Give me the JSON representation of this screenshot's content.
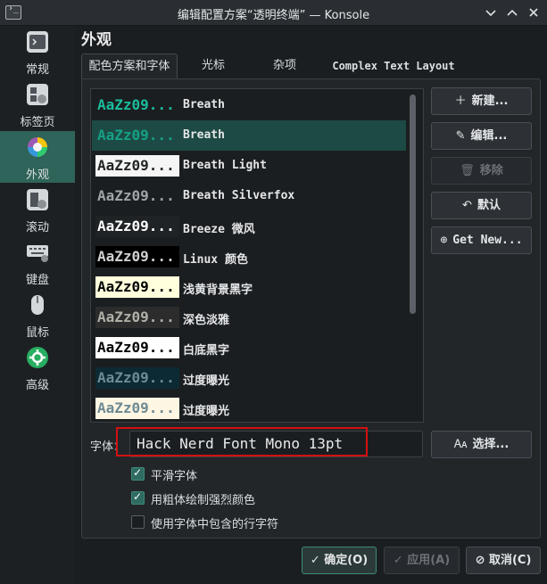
{
  "window": {
    "title": "编辑配置方案“透明终端” — Konsole",
    "icons": [
      "konsole-icon",
      "minimize-chevron",
      "maximize-chevron",
      "close-x"
    ]
  },
  "sidebar": {
    "items": [
      {
        "label": "常规",
        "icon": "terminal-icon"
      },
      {
        "label": "标签页",
        "icon": "tabs-icon"
      },
      {
        "label": "外观",
        "icon": "palette-icon"
      },
      {
        "label": "滚动",
        "icon": "scroll-icon"
      },
      {
        "label": "键盘",
        "icon": "keyboard-icon"
      },
      {
        "label": "鼠标",
        "icon": "mouse-icon"
      },
      {
        "label": "高级",
        "icon": "gear-icon"
      }
    ],
    "active": "外观"
  },
  "page": {
    "title": "外观",
    "tabs": [
      {
        "label": "配色方案和字体"
      },
      {
        "label": "光标"
      },
      {
        "label": "杂项"
      },
      {
        "label": "Complex Text Layout"
      }
    ]
  },
  "schemes": {
    "sample_text": "AaZz09...",
    "items": [
      {
        "name": "Breath",
        "bg": "#1b1e20",
        "fg": "#1abc9c"
      },
      {
        "name": "Breath",
        "bg": "#1d4a44",
        "fg": "#16a085"
      },
      {
        "name": "Breath Light",
        "bg": "#f5f5f5",
        "fg": "#232627"
      },
      {
        "name": "Breath Silverfox",
        "bg": "#1b1e20",
        "fg": "#a0a4a8"
      },
      {
        "name": "Breeze 微风",
        "bg": "#1f2326",
        "fg": "#fcfcfc"
      },
      {
        "name": "Linux 颜色",
        "bg": "#000000",
        "fg": "#d0d0d0"
      },
      {
        "name": "浅黄背景黑字",
        "bg": "#ffffdd",
        "fg": "#000000"
      },
      {
        "name": "深色淡雅",
        "bg": "#2c2c2c",
        "fg": "#b0b0a8"
      },
      {
        "name": "白底黑字",
        "bg": "#ffffff",
        "fg": "#000000"
      },
      {
        "name": "过度曝光",
        "bg": "#0c2a33",
        "fg": "#6e8a94"
      },
      {
        "name": "过度曝光",
        "bg": "#fdf6e3",
        "fg": "#6e8a94"
      }
    ]
  },
  "actions": {
    "new": "新建...",
    "edit": "编辑...",
    "remove": "移除",
    "default": "默认",
    "get_new": "Get New..."
  },
  "font": {
    "label": "字体：",
    "value": "Hack Nerd Font Mono 13pt",
    "select": "选择..."
  },
  "options": [
    {
      "label": "平滑字体",
      "checked": true
    },
    {
      "label": "用粗体绘制强烈颜色",
      "checked": true
    },
    {
      "label": "使用字体中包含的行字符",
      "checked": false
    }
  ],
  "footer": {
    "ok": "确定(O)",
    "apply": "应用(A)",
    "cancel": "取消(C)"
  },
  "colors": {
    "accent": "#2e6459",
    "highlight": "#d41010"
  }
}
